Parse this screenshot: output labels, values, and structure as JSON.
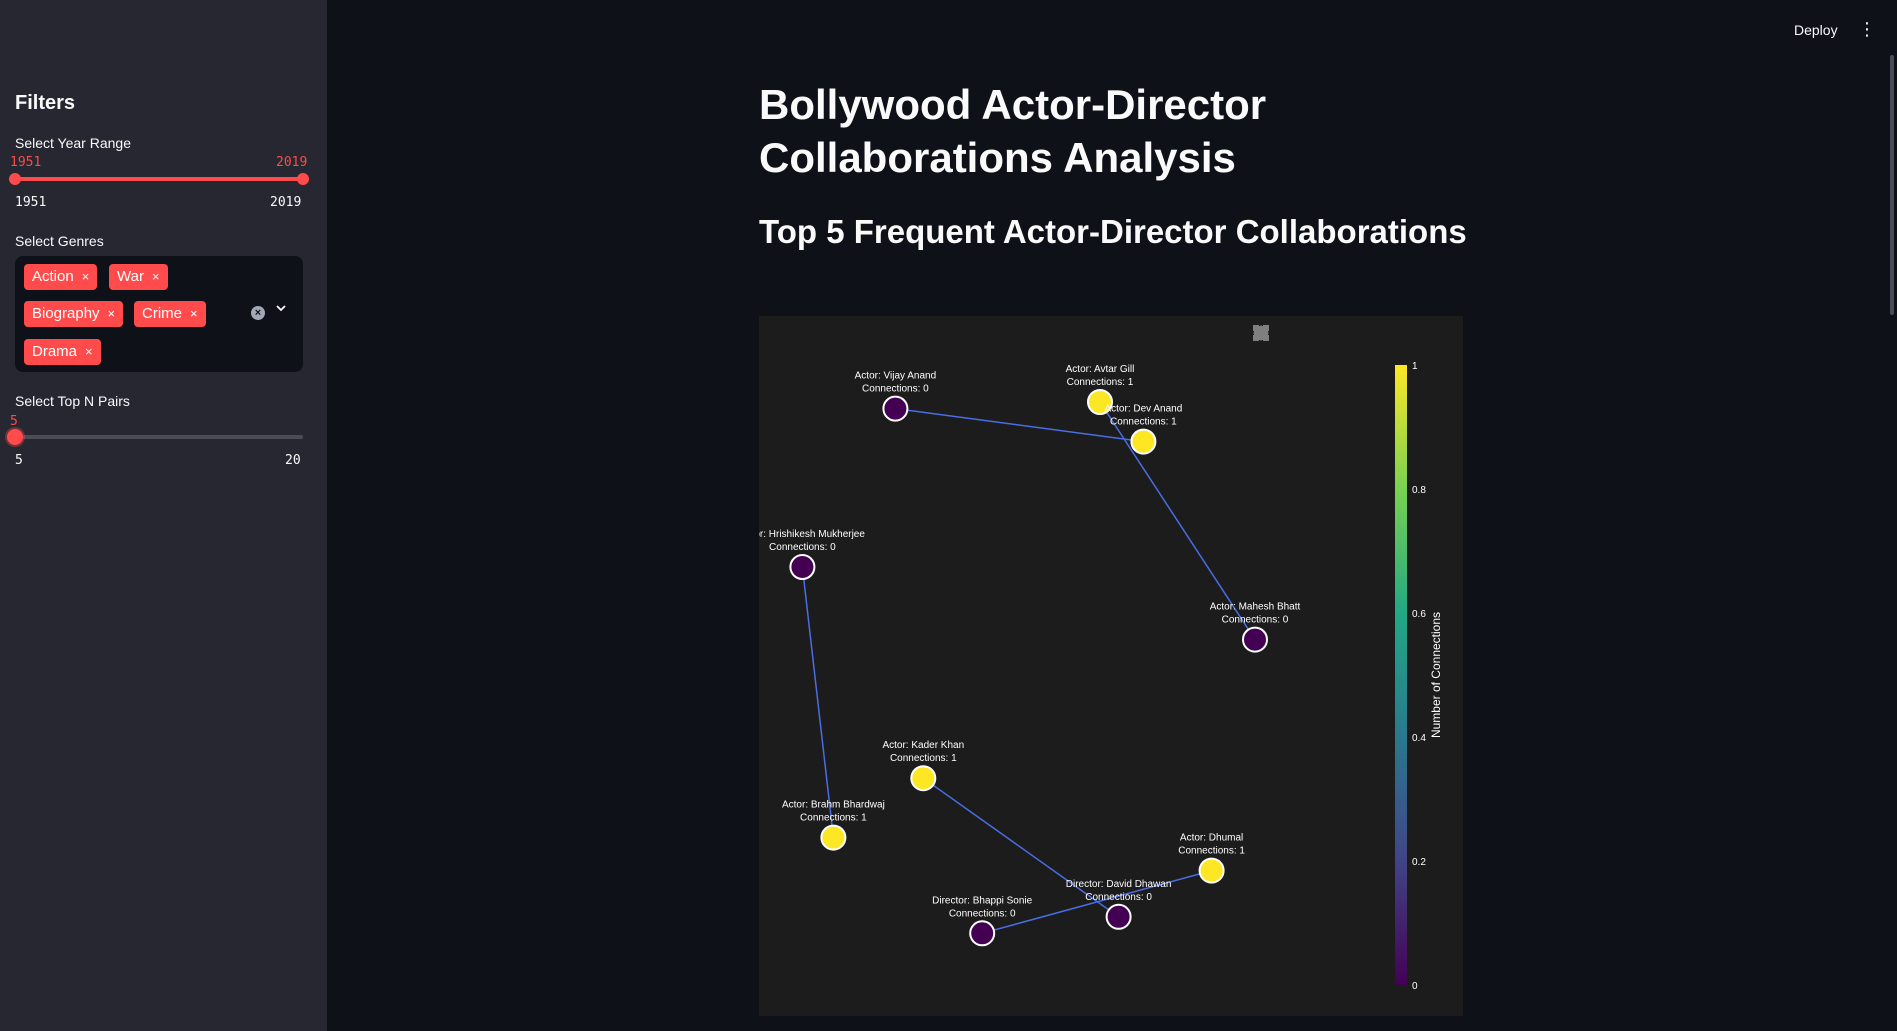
{
  "sidebar": {
    "heading": "Filters",
    "year_range": {
      "label": "Select Year Range",
      "value_low": "1951",
      "value_high": "2019",
      "min_label": "1951",
      "max_label": "2019"
    },
    "genres": {
      "label": "Select Genres",
      "selected": [
        "Action",
        "War",
        "Biography",
        "Crime",
        "Drama"
      ],
      "remove_glyph": "×"
    },
    "top_n": {
      "label": "Select Top N Pairs",
      "value": "5",
      "min_label": "5",
      "max_label": "20"
    }
  },
  "header": {
    "deploy_label": "Deploy",
    "menu_glyph": "⋮"
  },
  "main": {
    "title": "Bollywood Actor-Director Collaborations Analysis",
    "subtitle": "Top 5 Frequent Actor-Director Collaborations"
  },
  "modebar_icons": [
    "camera-icon",
    "zoom-icon",
    "pan-icon",
    "zoom-in-icon",
    "zoom-out-icon",
    "autoscale-icon",
    "home-icon",
    "fullscreen-icon"
  ],
  "colors": {
    "accent": "#ff4b4b",
    "edge": "#4a6de5",
    "node_high": "#fde725",
    "node_low": "#440154"
  },
  "chart_data": {
    "type": "network",
    "colorbar": {
      "title": "Number of Connections",
      "ticks": [
        "0",
        "0.2",
        "0.4",
        "0.6",
        "0.8",
        "1"
      ],
      "colorscale": "Viridis"
    },
    "nodes": [
      {
        "id": "vijay",
        "line1": "Actor: Vijay Anand",
        "line2": "Connections: 0",
        "value": 0,
        "x": 0.22,
        "y": 0.89
      },
      {
        "id": "avtar",
        "line1": "Actor: Avtar Gill",
        "line2": "Connections: 1",
        "value": 1,
        "x": 0.55,
        "y": 0.9
      },
      {
        "id": "dev",
        "line1": "Actor: Dev Anand",
        "line2": "Connections: 1",
        "value": 1,
        "x": 0.62,
        "y": 0.84
      },
      {
        "id": "hrishi",
        "line1": "Actor: Hrishikesh Mukherjee",
        "line2": "Connections: 0",
        "value": 0,
        "x": 0.07,
        "y": 0.65
      },
      {
        "id": "mahesh",
        "line1": "Actor: Mahesh Bhatt",
        "line2": "Connections: 0",
        "value": 0,
        "x": 0.8,
        "y": 0.54
      },
      {
        "id": "kader",
        "line1": "Actor: Kader Khan",
        "line2": "Connections: 1",
        "value": 1,
        "x": 0.265,
        "y": 0.33
      },
      {
        "id": "brahm",
        "line1": "Actor: Brahm Bhardwaj",
        "line2": "Connections: 1",
        "value": 1,
        "x": 0.12,
        "y": 0.24
      },
      {
        "id": "dhumal",
        "line1": "Actor: Dhumal",
        "line2": "Connections: 1",
        "value": 1,
        "x": 0.73,
        "y": 0.19
      },
      {
        "id": "david",
        "line1": "Director: David Dhawan",
        "line2": "Connections: 0",
        "value": 0,
        "x": 0.58,
        "y": 0.12
      },
      {
        "id": "bhappi",
        "line1": "Director: Bhappi Sonie",
        "line2": "Connections: 0",
        "value": 0,
        "x": 0.36,
        "y": 0.095
      }
    ],
    "edges": [
      [
        "vijay",
        "dev"
      ],
      [
        "avtar",
        "mahesh"
      ],
      [
        "hrishi",
        "brahm"
      ],
      [
        "kader",
        "david"
      ],
      [
        "bhappi",
        "dhumal"
      ]
    ]
  }
}
